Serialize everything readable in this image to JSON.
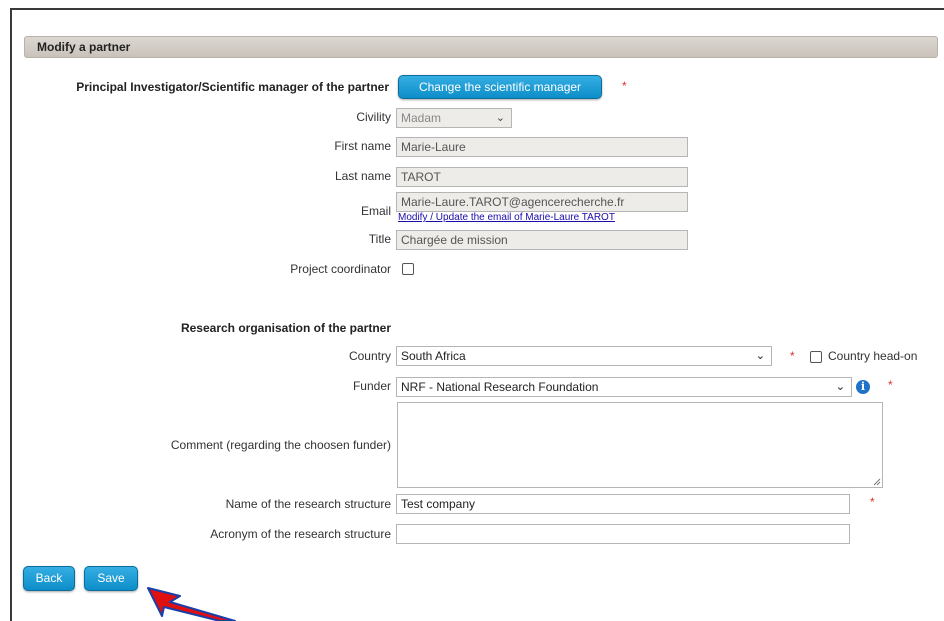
{
  "panel": {
    "title": "Modify a partner"
  },
  "pi": {
    "section_label": "Principal Investigator/Scientific manager of the partner",
    "change_button": "Change the scientific manager",
    "civility_label": "Civility",
    "civility_value": "Madam",
    "firstname_label": "First name",
    "firstname_value": "Marie-Laure",
    "lastname_label": "Last name",
    "lastname_value": "TAROT",
    "email_label": "Email",
    "email_value": "Marie-Laure.TAROT@agencerecherche.fr",
    "email_link": "Modify / Update the email of Marie-Laure TAROT",
    "title_label": "Title",
    "title_value": "Chargée de mission",
    "coordinator_label": "Project coordinator",
    "coordinator_checked": false
  },
  "org": {
    "section_label": "Research organisation of the partner",
    "country_label": "Country",
    "country_value": "South Africa",
    "country_head_label": "Country head-on",
    "funder_label": "Funder",
    "funder_value": "NRF - National Research Foundation",
    "comment_label": "Comment (regarding the choosen funder)",
    "comment_value": "",
    "structure_label": "Name of the research structure",
    "structure_value": "Test company",
    "acronym_label": "Acronym of the research structure",
    "acronym_value": ""
  },
  "required_mark": "*",
  "actions": {
    "back": "Back",
    "save": "Save"
  },
  "colors": {
    "button": "#1a9bd6",
    "header": "#d3ccc5",
    "required": "#e03030",
    "arrow": "#e01010"
  }
}
